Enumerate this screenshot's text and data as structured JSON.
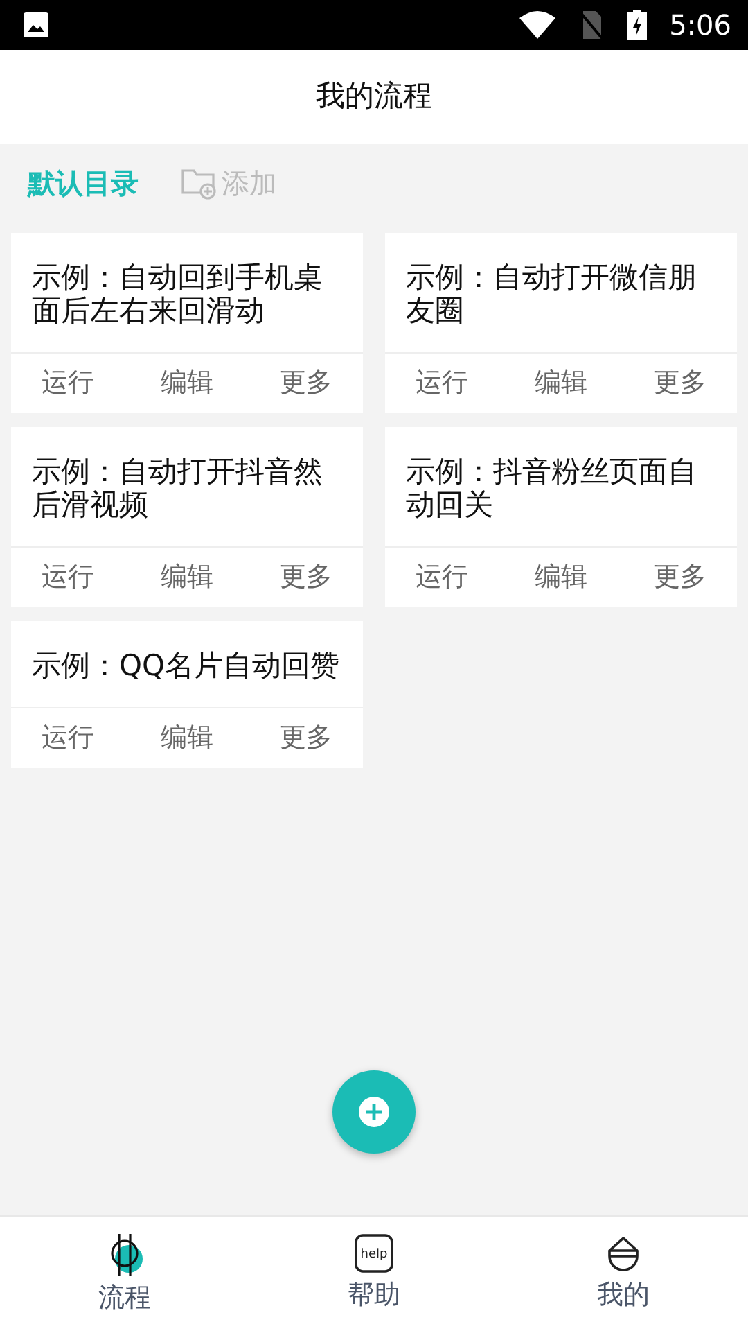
{
  "status_bar": {
    "time": "5:06"
  },
  "header": {
    "title": "我的流程"
  },
  "folders": [
    {
      "label": "默认目录",
      "kind": "folder",
      "selected": true
    },
    {
      "label": "添加",
      "kind": "add",
      "selected": false
    }
  ],
  "flows": [
    {
      "title": "示例：自动回到手机桌面后左右来回滑动",
      "actions": [
        "运行",
        "编辑",
        "更多"
      ]
    },
    {
      "title": "示例：自动打开微信朋友圈",
      "actions": [
        "运行",
        "编辑",
        "更多"
      ]
    },
    {
      "title": "示例：自动打开抖音然后滑视频",
      "actions": [
        "运行",
        "编辑",
        "更多"
      ]
    },
    {
      "title": "示例：抖音粉丝页面自动回关",
      "actions": [
        "运行",
        "编辑",
        "更多"
      ]
    },
    {
      "title": "示例：QQ名片自动回赞",
      "actions": [
        "运行",
        "编辑",
        "更多"
      ]
    }
  ],
  "bottom_nav": [
    {
      "label": "流程",
      "kind": "flow",
      "selected": true
    },
    {
      "label": "帮助",
      "kind": "help",
      "icon_text": "help",
      "selected": false
    },
    {
      "label": "我的",
      "kind": "me",
      "selected": false
    }
  ]
}
